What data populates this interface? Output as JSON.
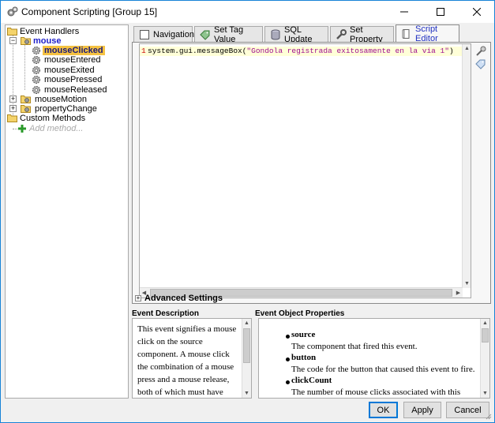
{
  "window": {
    "title": "Component Scripting [Group 15]",
    "controls": [
      "minimize",
      "maximize",
      "close"
    ]
  },
  "tree": {
    "root_label": "Event Handlers",
    "mouse_label": "mouse",
    "mouse_items": [
      "mouseClicked",
      "mouseEntered",
      "mouseExited",
      "mousePressed",
      "mouseReleased"
    ],
    "selected": "mouseClicked",
    "mouse_motion_label": "mouseMotion",
    "property_change_label": "propertyChange",
    "custom_methods_label": "Custom Methods",
    "add_method_label": "Add method..."
  },
  "tabs": [
    {
      "label": "Navigation",
      "icon": "checkbox-icon",
      "active": false
    },
    {
      "label": "Set Tag Value",
      "icon": "tag-value-icon",
      "active": false
    },
    {
      "label": "SQL Update",
      "icon": "database-icon",
      "active": false
    },
    {
      "label": "Set Property",
      "icon": "wrench-icon",
      "active": false
    },
    {
      "label": "Script Editor",
      "icon": "script-icon",
      "active": true
    }
  ],
  "editor": {
    "line_number": "1",
    "code_prefix": "system.gui.messageBox(",
    "code_string": "\"Gondola registrada exitosamente en la via 1\"",
    "code_suffix": ")"
  },
  "advanced_settings_label": "Advanced Settings",
  "event_description": {
    "heading": "Event Description",
    "text": "This event signifies a mouse click on the source component. A mouse click the combination of a mouse press and a mouse release, both of which must have occurred over the source"
  },
  "event_object_properties": {
    "heading": "Event Object Properties",
    "items": [
      {
        "name": "source",
        "desc": "The component that fired this event."
      },
      {
        "name": "button",
        "desc": "The code for the button that caused this event to fire."
      },
      {
        "name": "clickCount",
        "desc": "The number of mouse clicks associated with this"
      }
    ]
  },
  "buttons": {
    "ok": "OK",
    "apply": "Apply",
    "cancel": "Cancel"
  },
  "colors": {
    "selection": "#f5c242",
    "active_tab_text": "#2030c0",
    "code_string": "#a01090",
    "current_line": "#ffffd8",
    "window_border": "#1883d7"
  }
}
